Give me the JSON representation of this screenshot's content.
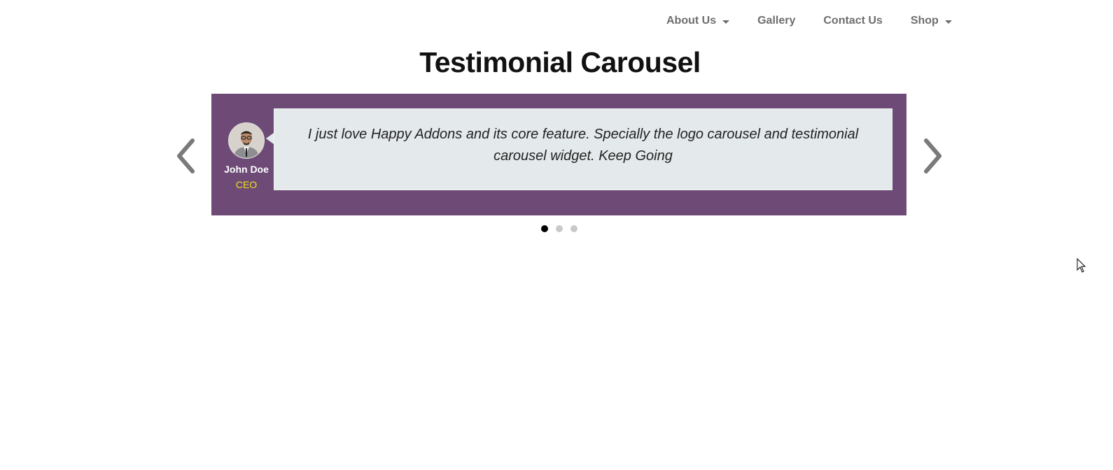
{
  "nav": {
    "items": [
      {
        "label": "About Us",
        "has_dropdown": true
      },
      {
        "label": "Gallery",
        "has_dropdown": false
      },
      {
        "label": "Contact Us",
        "has_dropdown": false
      },
      {
        "label": "Shop",
        "has_dropdown": true
      }
    ]
  },
  "page": {
    "title": "Testimonial Carousel"
  },
  "carousel": {
    "active_slide": 1,
    "slide_count": 3,
    "slide": {
      "author_name": "John Doe",
      "author_role": "CEO",
      "quote": "I just love Happy Addons and its core feature. Specially the logo carousel and testimonial carousel widget. Keep Going"
    },
    "prev_icon": "chevron-left-icon",
    "next_icon": "chevron-right-icon"
  },
  "colors": {
    "nav_text": "#6e6e6e",
    "title_text": "#111111",
    "carousel_background": "#6e4b77",
    "bubble_background": "#e4e9ec",
    "author_name": "#ffffff",
    "author_role": "#f2de1b",
    "arrow": "#7a7a7a",
    "dot_active": "#000000",
    "dot_inactive": "#c9c9c9"
  }
}
